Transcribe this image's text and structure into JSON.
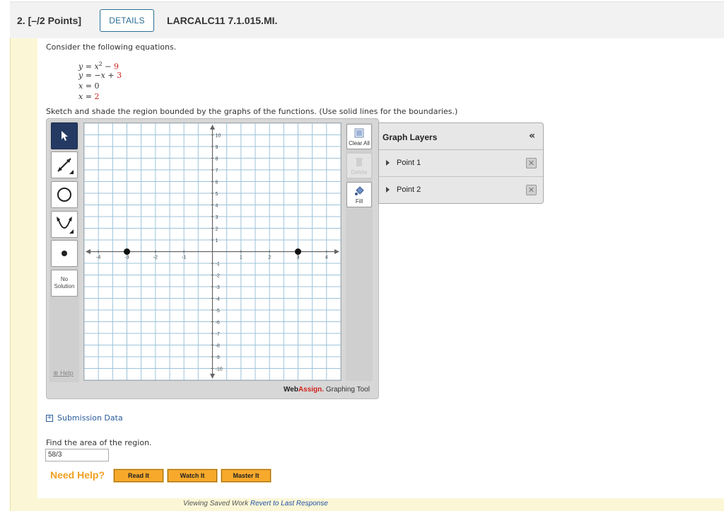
{
  "header": {
    "question_number": "2.",
    "points": "[–/2 Points]",
    "details_label": "DETAILS",
    "question_id": "LARCALC11 7.1.015.MI."
  },
  "prompt": {
    "intro": "Consider the following equations.",
    "equations": [
      {
        "lhs": "y",
        "op": "=",
        "body": "x² − ",
        "num": "9"
      },
      {
        "lhs": "y",
        "op": "=",
        "body": "−x + ",
        "num": "3"
      },
      {
        "lhs": "x",
        "op": "=",
        "body": "0",
        "num": ""
      },
      {
        "lhs": "x",
        "op": "=",
        "body": "",
        "num": "2"
      }
    ],
    "instruction": "Sketch and shade the region bounded by the graphs of the functions. (Use solid lines for the boundaries.)"
  },
  "graph_tool": {
    "no_solution_label": "No Solution",
    "help_label": "Help",
    "clear_all_label": "Clear All",
    "delete_label": "Delete",
    "fill_label": "Fill",
    "brand_web": "Web",
    "brand_assign": "Assign.",
    "brand_suffix": " Graphing Tool",
    "x_ticks": [
      "-4",
      "-3",
      "-2",
      "-1",
      "1",
      "2",
      "3",
      "4"
    ],
    "y_ticks": [
      "10",
      "9",
      "8",
      "7",
      "6",
      "5",
      "4",
      "3",
      "2",
      "1",
      "-1",
      "-2",
      "-3",
      "-4",
      "-5",
      "-6",
      "-7",
      "-8",
      "-9",
      "-10"
    ],
    "points": [
      {
        "x": -3,
        "y": 0
      },
      {
        "x": 3,
        "y": 0
      }
    ],
    "x_range": [
      -4.5,
      4.5
    ],
    "y_range": [
      -11,
      11
    ]
  },
  "layers": {
    "title": "Graph Layers",
    "collapse_icon": "«",
    "items": [
      {
        "label": "Point 1"
      },
      {
        "label": "Point 2"
      }
    ]
  },
  "submission_label": "Submission Data",
  "area_question": "Find the area of the region.",
  "answer_value": "58/3",
  "help": {
    "need_help": "Need Help?",
    "read_it": "Read It",
    "watch_it": "Watch It",
    "master_it": "Master It"
  },
  "footer": {
    "viewing": "Viewing Saved Work ",
    "revert": "Revert to Last Response"
  }
}
